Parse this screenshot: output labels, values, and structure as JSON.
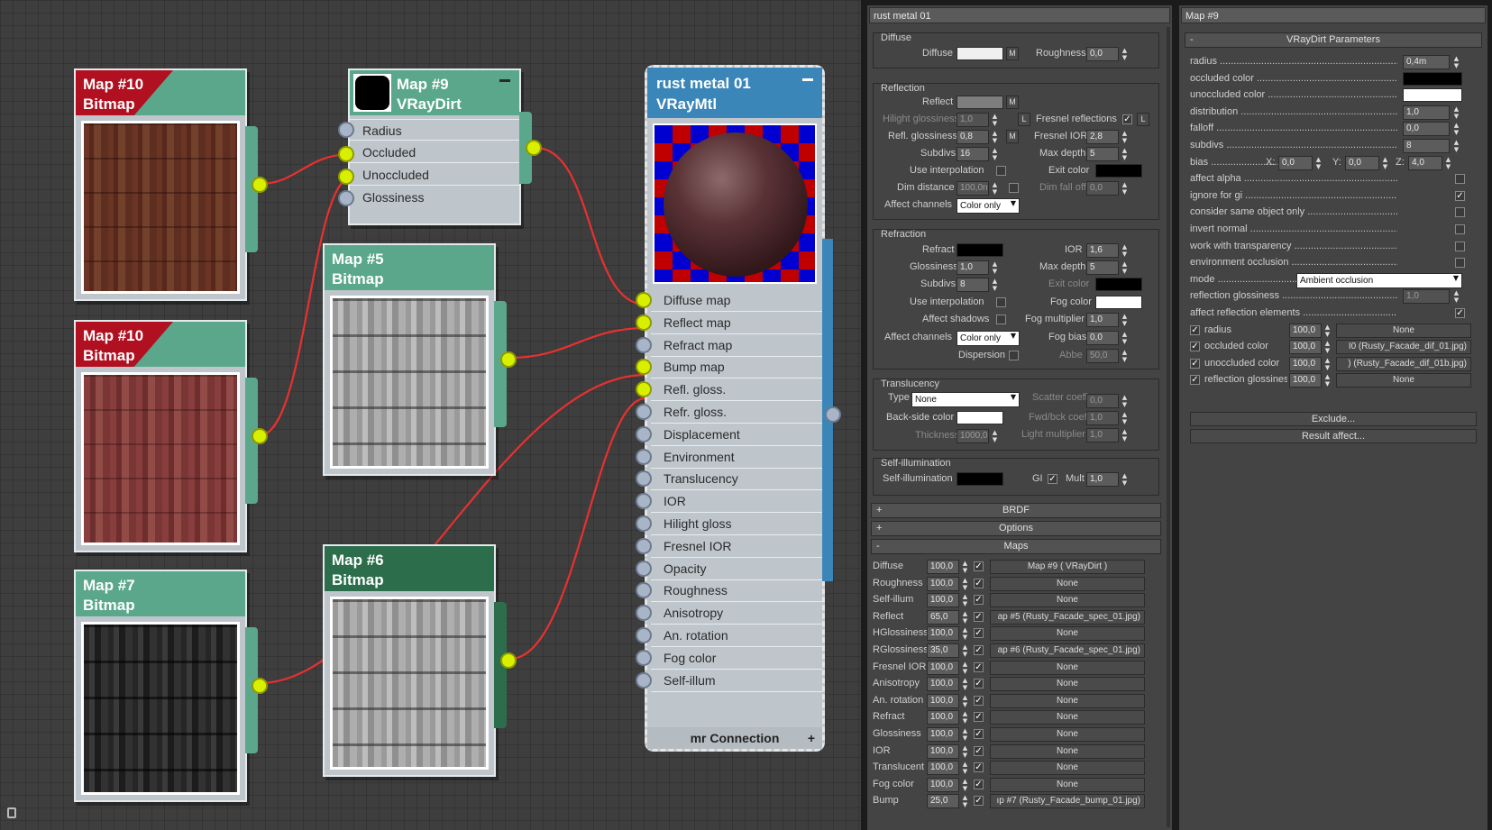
{
  "nodes": {
    "map10a": {
      "title": "Map #10",
      "type": "Bitmap"
    },
    "map10b": {
      "title": "Map #10",
      "type": "Bitmap"
    },
    "map7": {
      "title": "Map #7",
      "type": "Bitmap"
    },
    "map9": {
      "title": "Map #9",
      "type": "VRayDirt",
      "inputs": [
        "Radius",
        "Occluded",
        "Unoccluded",
        "Glossiness"
      ]
    },
    "map5": {
      "title": "Map #5",
      "type": "Bitmap"
    },
    "map6": {
      "title": "Map #6",
      "type": "Bitmap"
    },
    "mtl": {
      "title": "rust metal 01",
      "type": "VRayMtl",
      "footer": "mr Connection",
      "slots": [
        "Diffuse map",
        "Reflect map",
        "Refract map",
        "Bump map",
        "Refl. gloss.",
        "Refr. gloss.",
        "Displacement",
        "Environment",
        "Translucency",
        "IOR",
        "Hilight gloss",
        "Fresnel IOR",
        "Opacity",
        "Roughness",
        "Anisotropy",
        "An. rotation",
        "Fog color",
        "Self-illum"
      ]
    }
  },
  "mid_panel": {
    "title": "rust metal 01",
    "diffuse": {
      "group": "Diffuse",
      "diffuse_label": "Diffuse",
      "m": "M",
      "roughness_label": "Roughness",
      "roughness": "0,0"
    },
    "reflection": {
      "group": "Reflection",
      "reflect": "Reflect",
      "m": "M",
      "hilight_label": "Hilight glossiness",
      "hilight": "1,0",
      "l": "L",
      "fresnel_label": "Fresnel reflections",
      "refl_gloss_label": "Refl. glossiness",
      "refl_gloss": "0,8",
      "fresnel_ior_label": "Fresnel IOR",
      "fresnel_ior": "2,8",
      "subdivs_label": "Subdivs",
      "subdivs": "16",
      "max_depth_label": "Max depth",
      "max_depth": "5",
      "use_interp": "Use interpolation",
      "exit_color": "Exit color",
      "dim_distance_label": "Dim distance",
      "dim_distance": "100,0n",
      "dim_falloff_label": "Dim fall off",
      "dim_falloff": "0,0",
      "affect_label": "Affect channels",
      "affect": "Color only"
    },
    "refraction": {
      "group": "Refraction",
      "refract": "Refract",
      "ior_label": "IOR",
      "ior": "1,6",
      "gloss_label": "Glossiness",
      "gloss": "1,0",
      "max_depth_label": "Max depth",
      "max_depth": "5",
      "subdivs_label": "Subdivs",
      "subdivs": "8",
      "exit_color": "Exit color",
      "use_interp": "Use interpolation",
      "fog_color": "Fog color",
      "affect_shadows": "Affect shadows",
      "fog_mult_label": "Fog multiplier",
      "fog_mult": "1,0",
      "affect_label": "Affect channels",
      "affect": "Color only",
      "fog_bias_label": "Fog bias",
      "fog_bias": "0,0",
      "dispersion": "Dispersion",
      "abbe_label": "Abbe",
      "abbe": "50,0"
    },
    "translucency": {
      "group": "Translucency",
      "type_label": "Type",
      "type": "None",
      "scatter_label": "Scatter coeff",
      "scatter": "0,0",
      "backside_label": "Back-side color",
      "fwdbck_label": "Fwd/bck coeff",
      "fwdbck": "1,0",
      "thickness_label": "Thickness",
      "thickness": "1000,0",
      "light_mult_label": "Light multiplier",
      "light_mult": "1,0"
    },
    "selfillum": {
      "group": "Self-illumination",
      "label": "Self-illumination",
      "gi": "GI",
      "mult_label": "Mult",
      "mult": "1,0"
    },
    "rollouts": {
      "brdf": "BRDF",
      "options": "Options",
      "maps": "Maps",
      "plus": "+",
      "minus": "-"
    },
    "maps": [
      {
        "name": "Diffuse",
        "amount": "100,0",
        "map": "Map #9  ( VRayDirt )"
      },
      {
        "name": "Roughness",
        "amount": "100,0",
        "map": "None"
      },
      {
        "name": "Self-illum",
        "amount": "100,0",
        "map": "None"
      },
      {
        "name": "Reflect",
        "amount": "65,0",
        "map": "ap #5 (Rusty_Facade_spec_01.jpg)"
      },
      {
        "name": "HGlossiness",
        "amount": "100,0",
        "map": "None"
      },
      {
        "name": "RGlossiness",
        "amount": "35,0",
        "map": "ap #6 (Rusty_Facade_spec_01.jpg)"
      },
      {
        "name": "Fresnel IOR",
        "amount": "100,0",
        "map": "None"
      },
      {
        "name": "Anisotropy",
        "amount": "100,0",
        "map": "None"
      },
      {
        "name": "An. rotation",
        "amount": "100,0",
        "map": "None"
      },
      {
        "name": "Refract",
        "amount": "100,0",
        "map": "None"
      },
      {
        "name": "Glossiness",
        "amount": "100,0",
        "map": "None"
      },
      {
        "name": "IOR",
        "amount": "100,0",
        "map": "None"
      },
      {
        "name": "Translucent",
        "amount": "100,0",
        "map": "None"
      },
      {
        "name": "Fog color",
        "amount": "100,0",
        "map": "None"
      },
      {
        "name": "Bump",
        "amount": "25,0",
        "map": "ıp #7 (Rusty_Facade_bump_01.jpg)"
      }
    ]
  },
  "right_panel": {
    "title": "Map #9",
    "section": "VRayDirt Parameters",
    "minus": "-",
    "radius_label": "radius",
    "radius": "0,4m",
    "occluded_label": "occluded color",
    "unoccluded_label": "unoccluded color",
    "distribution_label": "distribution",
    "distribution": "1,0",
    "falloff_label": "falloff",
    "falloff": "0,0",
    "subdivs_label": "subdivs",
    "subdivs": "8",
    "bias_label": "bias",
    "bias_x_label": "X:",
    "bias_x": "0,0",
    "bias_y_label": "Y:",
    "bias_y": "0,0",
    "bias_z_label": "Z:",
    "bias_z": "4,0",
    "affect_alpha": "affect alpha",
    "ignore_gi": "ignore for gi",
    "same_object": "consider same object only",
    "invert_normal": "invert normal",
    "work_transp": "work with transparency",
    "env_occ": "environment occlusion",
    "mode_label": "mode",
    "mode": "Ambient occlusion",
    "refl_gloss_label": "reflection glossiness",
    "refl_gloss": "1,0",
    "affect_refl": "affect reflection elements",
    "map_rows": [
      {
        "name": "radius",
        "amount": "100,0",
        "map": "None"
      },
      {
        "name": "occluded color",
        "amount": "100,0",
        "map": "I0 (Rusty_Facade_dif_01.jpg)"
      },
      {
        "name": "unoccluded color",
        "amount": "100,0",
        "map": ") (Rusty_Facade_dif_01b.jpg)"
      },
      {
        "name": "reflection glossines",
        "amount": "100,0",
        "map": "None"
      }
    ],
    "exclude": "Exclude...",
    "result": "Result affect..."
  },
  "colors": {
    "wire": "#e83030",
    "port": "#d8f000",
    "node_header": "#5aa78c",
    "mtl_header": "#3b86b9",
    "red_tag": "#b01020"
  }
}
